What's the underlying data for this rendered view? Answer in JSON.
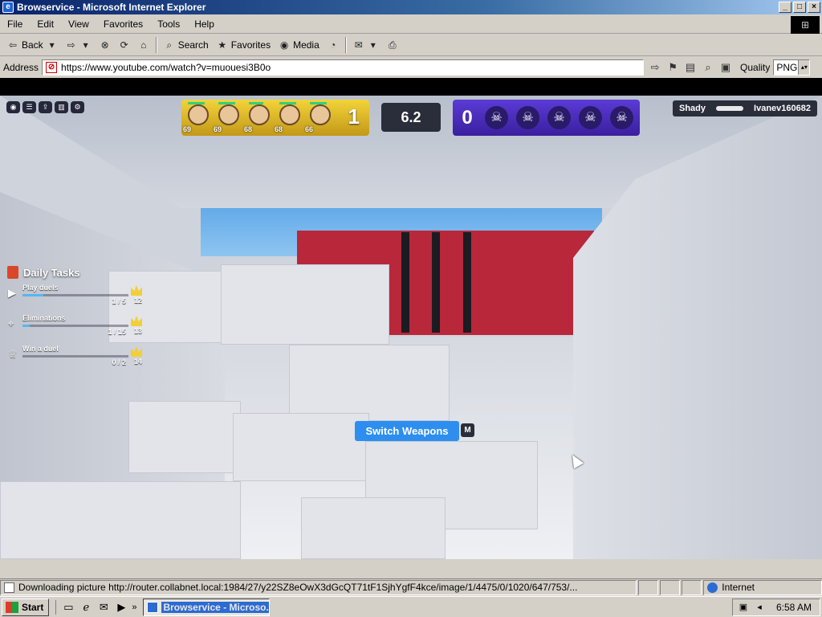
{
  "window": {
    "title": "Browservice - Microsoft Internet Explorer",
    "app_icon": "ie-icon",
    "controls": [
      "minimize",
      "maximize",
      "close"
    ]
  },
  "menu": [
    "File",
    "Edit",
    "View",
    "Favorites",
    "Tools",
    "Help"
  ],
  "toolbar": {
    "back_label": "Back",
    "search_label": "Search",
    "favorites_label": "Favorites",
    "media_label": "Media"
  },
  "address": {
    "label": "Address",
    "url": "https://www.youtube.com/watch?v=muouesi3B0o",
    "quality_label": "Quality",
    "quality_value": "PNG"
  },
  "game": {
    "team": {
      "players": [
        {
          "num": "69",
          "hp": 0.8
        },
        {
          "num": "69",
          "hp": 0.8
        },
        {
          "num": "68",
          "hp": 0.7
        },
        {
          "num": "68",
          "hp": 0.8
        },
        {
          "num": "66",
          "hp": 0.8
        }
      ],
      "score": "1"
    },
    "timer": "6.2",
    "enemy": {
      "score": "0",
      "skull_count": 5
    },
    "killfeed": {
      "killer": "Shady",
      "victim": "Ivanev160682"
    },
    "daily_tasks": {
      "title": "Daily Tasks",
      "items": [
        {
          "icon": "play-icon",
          "name": "Play duels",
          "progress": "1 / 5",
          "fraction": 0.2,
          "reward": "12"
        },
        {
          "icon": "crosshair-icon",
          "name": "Eliminations",
          "progress": "1 / 15",
          "fraction": 0.07,
          "reward": "13"
        },
        {
          "icon": "trophy-icon",
          "name": "Win a duel",
          "progress": "0 / 2",
          "fraction": 0.0,
          "reward": "14"
        }
      ]
    },
    "switch_weapons": {
      "label": "Switch Weapons",
      "key": "M"
    }
  },
  "status": {
    "text": "Downloading picture http://router.collabnet.local:1984/27/y22SZ8eOwX3dGcQT71tF1SjhYgfF4kce/image/1/4475/0/1020/647/753/...",
    "zone": "Internet"
  },
  "taskbar": {
    "start_label": "Start",
    "task_label": "Browservice - Microso...",
    "clock": "6:58 AM"
  }
}
